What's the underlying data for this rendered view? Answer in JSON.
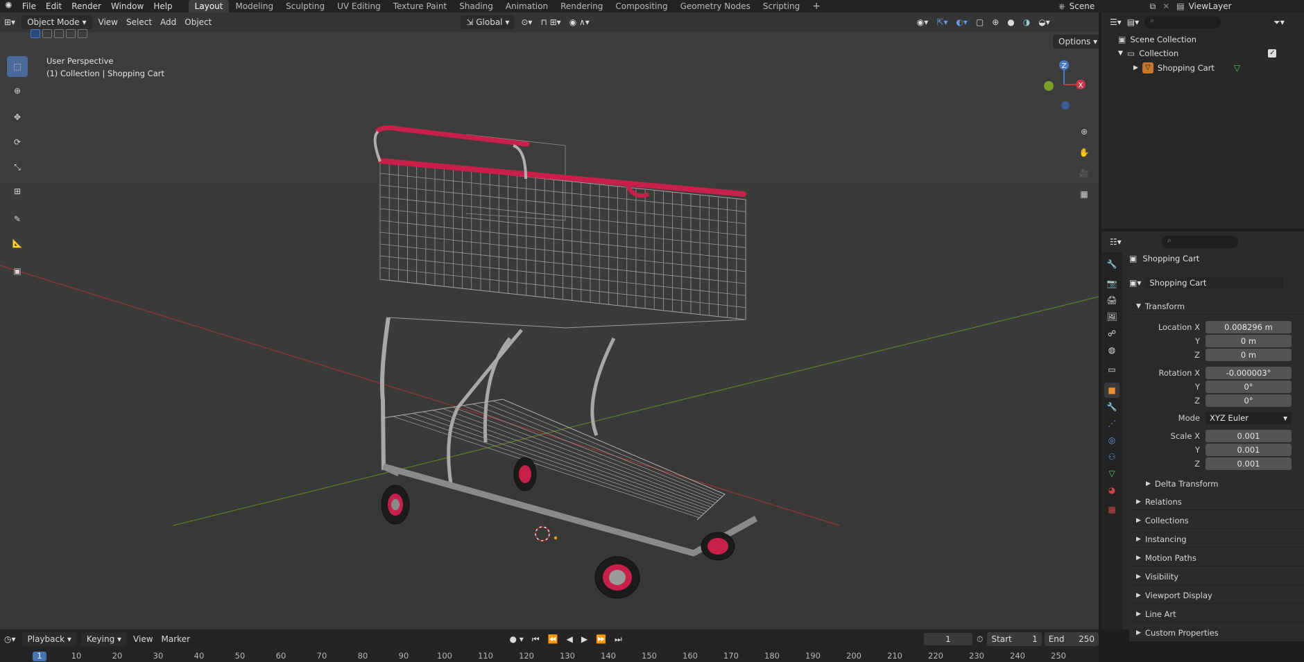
{
  "topbar": {
    "menus": [
      "File",
      "Edit",
      "Render",
      "Window",
      "Help"
    ],
    "workspaces": [
      "Layout",
      "Modeling",
      "Sculpting",
      "UV Editing",
      "Texture Paint",
      "Shading",
      "Animation",
      "Rendering",
      "Compositing",
      "Geometry Nodes",
      "Scripting"
    ],
    "active_workspace": "Layout",
    "scene": "Scene",
    "view_layer": "ViewLayer"
  },
  "viewport": {
    "mode": "Object Mode",
    "menus": [
      "View",
      "Select",
      "Add",
      "Object"
    ],
    "orientation": "Global",
    "options_label": "Options",
    "overlay_line1": "User Perspective",
    "overlay_line2": "(1) Collection | Shopping Cart",
    "gizmo": {
      "z": "Z",
      "x": "X"
    }
  },
  "outliner": {
    "scene_collection": "Scene Collection",
    "collection": "Collection",
    "object": "Shopping Cart"
  },
  "properties": {
    "header_object": "Shopping Cart",
    "data_object": "Shopping Cart",
    "transform_title": "Transform",
    "location": {
      "label": "Location X",
      "x": "0.008296 m",
      "y": "0 m",
      "z": "0 m"
    },
    "rotation": {
      "label": "Rotation X",
      "x": "-0.000003°",
      "y": "0°",
      "z": "0°"
    },
    "mode_label": "Mode",
    "mode_value": "XYZ Euler",
    "scale": {
      "label": "Scale X",
      "x": "0.001",
      "y": "0.001",
      "z": "0.001"
    },
    "axis_y": "Y",
    "axis_z": "Z",
    "delta": "Delta Transform",
    "panels": [
      "Relations",
      "Collections",
      "Instancing",
      "Motion Paths",
      "Visibility",
      "Viewport Display",
      "Line Art",
      "Custom Properties"
    ]
  },
  "timeline": {
    "menus": [
      "Playback",
      "Keying",
      "View",
      "Marker"
    ],
    "current_frame": "1",
    "start_label": "Start",
    "start": "1",
    "end_label": "End",
    "end": "250",
    "ticks": [
      "1",
      "10",
      "20",
      "30",
      "40",
      "50",
      "60",
      "70",
      "80",
      "90",
      "100",
      "110",
      "120",
      "130",
      "140",
      "150",
      "160",
      "170",
      "180",
      "190",
      "200",
      "210",
      "220",
      "230",
      "240",
      "250"
    ]
  },
  "colors": {
    "accent": "#4772b3",
    "cart_handle": "#c8204a",
    "x_axis": "#9a3a3a",
    "y_axis": "#6a8a2a"
  }
}
